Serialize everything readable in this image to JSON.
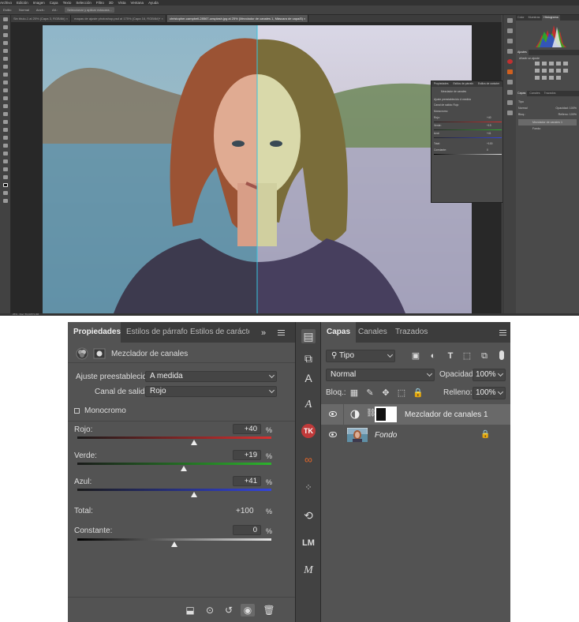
{
  "app": {
    "menu": [
      "Archivo",
      "Edición",
      "Imagen",
      "Capa",
      "Texto",
      "Selección",
      "Filtro",
      "3D",
      "Vista",
      "Ventana",
      "Ayuda"
    ],
    "options_bar": {
      "items": [
        "Estilo:",
        "Normal",
        "Anch.:",
        "Alt.:"
      ],
      "button": "Seleccionar y aplicar máscara..."
    },
    "doc_tabs": [
      {
        "label": "Sin título-1 al 25% (Capa 3, RGB/8#) ×",
        "active": false
      },
      {
        "label": "mapas de ajuste photoshop.psd al 175% (Capa 16, RGB/8#)* ×",
        "active": false
      },
      {
        "label": "christopher-campbell-28567-unsplash.jpg al 25% (Mezclador de canales 1, Máscara de capa/8) ×",
        "active": true
      }
    ],
    "status_text": "25% · Doc: 59,1M/71,3M",
    "mini_properties": {
      "tabs": [
        "Propiedades",
        "Estilos de párrafo",
        "Estilos de carácter"
      ],
      "title": "Mezclador de canales",
      "rows": [
        "Ajuste preestablecido:  A medida",
        "Canal de salida:  Rojo",
        "Monocromo",
        "Rojo:",
        "+40",
        "Verde:",
        "+19",
        "Azul:",
        "+41",
        "Total:",
        "+100",
        "Constante:",
        "0"
      ]
    },
    "right_panel": {
      "top_tabs": [
        "Color",
        "Muestras",
        "Histograma"
      ],
      "mid_tabs": [
        "Ajustes"
      ],
      "mid_label": "Añadir un ajuste",
      "layer_tabs": [
        "Capas",
        "Canales",
        "Trazados"
      ],
      "filter": "Tipo",
      "blend": "Normal",
      "opacity_label": "Opacidad: 100%",
      "fill_label": "Relleno: 100%",
      "lock_label": "Bloq.:",
      "layers": [
        "Mezclador de canales 1",
        "Fondo"
      ]
    }
  },
  "properties": {
    "tabs": [
      "Propiedades",
      "Estilos de párrafo",
      "Estilos de carácter"
    ],
    "panel_title": "Mezclador de canales",
    "preset_label": "Ajuste preestablecido:",
    "preset_value": "A medida",
    "output_label": "Canal de salida:",
    "output_value": "Rojo",
    "monochrome_label": "Monocromo",
    "monochrome_checked": false,
    "sliders": [
      {
        "label": "Rojo:",
        "value": "+40",
        "unit": "%",
        "position": 0.6,
        "color": "#d63030"
      },
      {
        "label": "Verde:",
        "value": "+19",
        "unit": "%",
        "position": 0.55,
        "color": "#2cb32c"
      },
      {
        "label": "Azul:",
        "value": "+41",
        "unit": "%",
        "position": 0.6,
        "color": "#3344dd"
      }
    ],
    "total_label": "Total:",
    "total_value": "+100",
    "total_unit": "%",
    "constant_label": "Constante:",
    "constant_value": "0",
    "constant_unit": "%",
    "constant_position": 0.5
  },
  "dock_icons": [
    "layer-comps-icon",
    "adjustments-icon",
    "character-icon",
    "glyphs-icon",
    "tk-plugin-icon",
    "infinity-plugin-icon",
    "brush-preset-icon",
    "history-icon",
    "lm-plugin-icon",
    "m-plugin-icon"
  ],
  "layers_panel": {
    "tabs": [
      "Capas",
      "Canales",
      "Trazados"
    ],
    "filter_label": "Tipo",
    "blend_mode": "Normal",
    "opacity_label": "Opacidad:",
    "opacity_value": "100%",
    "lock_label": "Bloq.:",
    "fill_label": "Relleno:",
    "fill_value": "100%",
    "layers": [
      {
        "name": "Mezclador de canales 1",
        "selected": true,
        "italic": false
      },
      {
        "name": "Fondo",
        "selected": false,
        "italic": true
      }
    ]
  }
}
